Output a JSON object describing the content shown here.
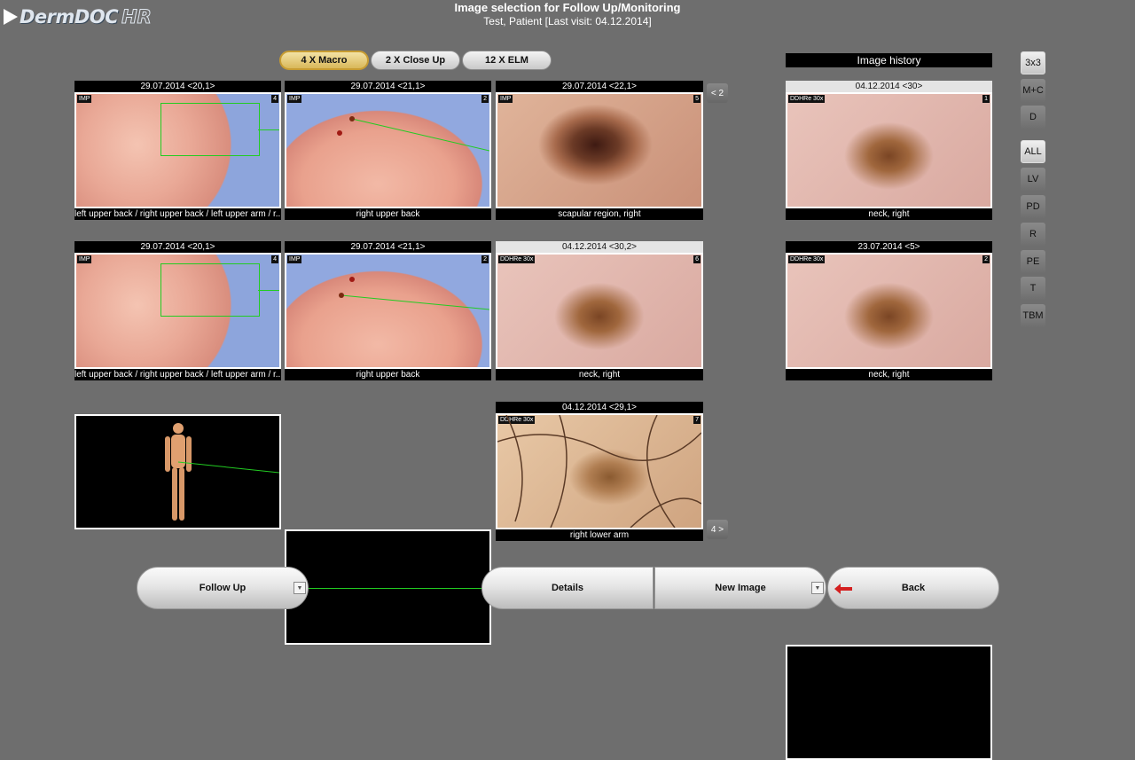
{
  "app": {
    "logo_text": "DermDOC",
    "logo_suffix": "HR",
    "title": "Image selection for Follow Up/Monitoring",
    "subtitle": "Test, Patient [Last visit: 04.12.2014]"
  },
  "tabs": [
    {
      "label": "4 X Macro",
      "active": true
    },
    {
      "label": "2 X Close Up",
      "active": false
    },
    {
      "label": "12 X ELM",
      "active": false
    }
  ],
  "grid": {
    "row1": [
      {
        "header": "29.07.2014 <20,1>",
        "tag": "IMP",
        "num": "4",
        "caption": "left upper back / right upper back / left upper arm / r..."
      },
      {
        "header": "29.07.2014 <21,1>",
        "tag": "IMP",
        "num": "2",
        "caption": "right upper back"
      },
      {
        "header": "29.07.2014 <22,1>",
        "tag": "IMP",
        "num": "5",
        "caption": "scapular region, right"
      }
    ],
    "row2": [
      {
        "header": "29.07.2014 <20,1>",
        "tag": "IMP",
        "num": "4",
        "caption": "left upper back / right upper back / left upper arm / r..."
      },
      {
        "header": "29.07.2014 <21,1>",
        "tag": "IMP",
        "num": "2",
        "caption": "right upper back"
      },
      {
        "header": "04.12.2014 <30,2>",
        "tag": "DDHRe 30x",
        "num": "6",
        "caption": "neck, right"
      }
    ],
    "row3": [
      {
        "header": "04.12.2014 <29,1>",
        "tag": "DDHRe 30x",
        "num": "7",
        "caption": "right lower arm"
      }
    ]
  },
  "nav": {
    "prev_label": "< 2",
    "next_label": "4 >"
  },
  "history": {
    "title": "Image history",
    "items": [
      {
        "header": "04.12.2014 <30>",
        "tag": "DDHRe 30x",
        "num": "1",
        "caption": "neck, right"
      },
      {
        "header": "23.07.2014 <5>",
        "tag": "DDHRe 30x",
        "num": "2",
        "caption": "neck, right"
      }
    ]
  },
  "side_buttons": {
    "layout": [
      "3x3",
      "M+C",
      "D"
    ],
    "filters": [
      "ALL",
      "LV",
      "PD",
      "R",
      "PE",
      "T",
      "TBM"
    ],
    "active": [
      "3x3",
      "ALL"
    ]
  },
  "bottom": {
    "follow_up": "Follow Up",
    "details": "Details",
    "new_image": "New Image",
    "back": "Back"
  },
  "colors": {
    "background": "#6e6e6e",
    "active_tab": "#d9b85a",
    "marker_line": "#22cc22",
    "back_arrow": "#d42020"
  }
}
